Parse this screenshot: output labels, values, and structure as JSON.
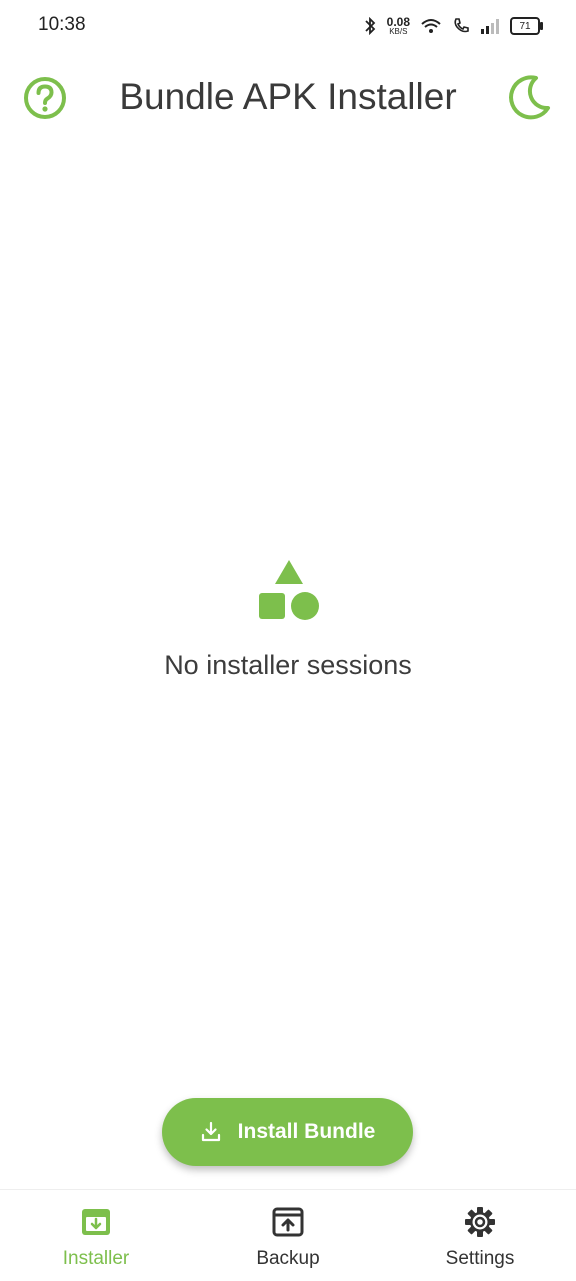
{
  "status_bar": {
    "time": "10:38",
    "net_speed": "0.08",
    "net_unit": "KB/S",
    "battery": "71",
    "icons": [
      "bluetooth-icon",
      "wifi-icon",
      "call-icon",
      "signal-icon",
      "battery-icon"
    ]
  },
  "header": {
    "title": "Bundle APK Installer",
    "left_icon": "help-icon",
    "right_icon": "moon-icon"
  },
  "empty_state": {
    "icon": "shapes-icon",
    "message": "No installer sessions"
  },
  "fab": {
    "label": "Install Bundle",
    "icon": "download-icon"
  },
  "bottom_nav": {
    "items": [
      {
        "label": "Installer",
        "icon": "installer-icon",
        "active": true
      },
      {
        "label": "Backup",
        "icon": "backup-icon",
        "active": false
      },
      {
        "label": "Settings",
        "icon": "gear-icon",
        "active": false
      }
    ]
  },
  "colors": {
    "accent": "#7dbf4c",
    "text": "#333333",
    "background": "#ffffff"
  }
}
